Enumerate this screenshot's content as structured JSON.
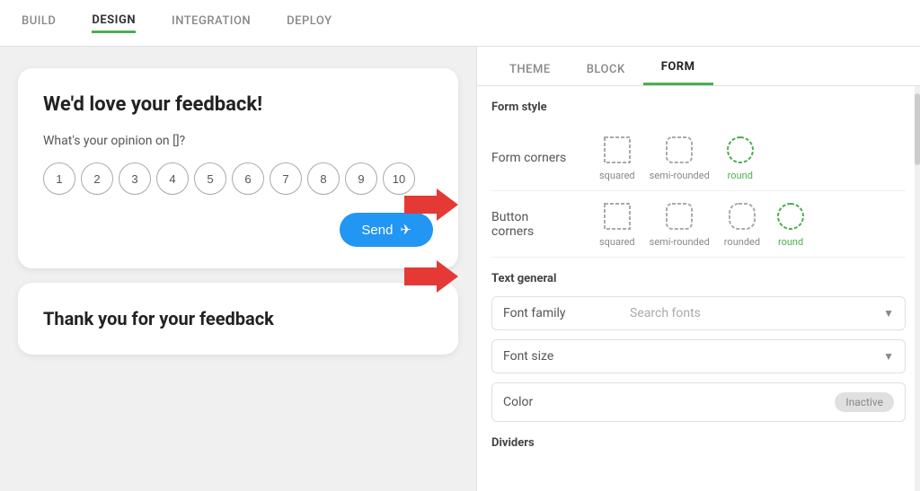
{
  "nav": {
    "items": [
      {
        "id": "build",
        "label": "BUILD",
        "active": false
      },
      {
        "id": "design",
        "label": "DESIGN",
        "active": true
      },
      {
        "id": "integration",
        "label": "INTEGRATION",
        "active": false
      },
      {
        "id": "deploy",
        "label": "DEPLOY",
        "active": false
      }
    ]
  },
  "left": {
    "feedback_card": {
      "title": "We'd love your feedback!",
      "question": "What's your opinion on []?",
      "rating_buttons": [
        "1",
        "2",
        "3",
        "4",
        "5",
        "6",
        "7",
        "8",
        "9",
        "10"
      ],
      "send_button": "Send"
    },
    "thankyou_card": {
      "title": "Thank you for your feedback"
    }
  },
  "right": {
    "tabs": [
      {
        "id": "theme",
        "label": "THEME",
        "active": false
      },
      {
        "id": "block",
        "label": "BLOCK",
        "active": false
      },
      {
        "id": "form",
        "label": "FORM",
        "active": true
      }
    ],
    "form_style": {
      "section_title": "Form style",
      "form_corners": {
        "label": "Form corners",
        "options": [
          {
            "id": "squared",
            "label": "squared",
            "selected": false
          },
          {
            "id": "semi-rounded",
            "label": "semi-rounded",
            "selected": false
          },
          {
            "id": "round",
            "label": "round",
            "selected": true
          }
        ]
      },
      "button_corners": {
        "label": "Button corners",
        "options": [
          {
            "id": "squared",
            "label": "squared",
            "selected": false
          },
          {
            "id": "semi-rounded",
            "label": "semi-rounded",
            "selected": false
          },
          {
            "id": "rounded",
            "label": "rounded",
            "selected": false
          },
          {
            "id": "round",
            "label": "round",
            "selected": true
          }
        ]
      }
    },
    "text_general": {
      "section_title": "Text general",
      "font_family_label": "Font family",
      "font_family_placeholder": "Search fonts",
      "font_size_label": "Font size",
      "color_label": "Color",
      "color_value": "Inactive"
    },
    "dividers": {
      "section_title": "Dividers"
    }
  }
}
